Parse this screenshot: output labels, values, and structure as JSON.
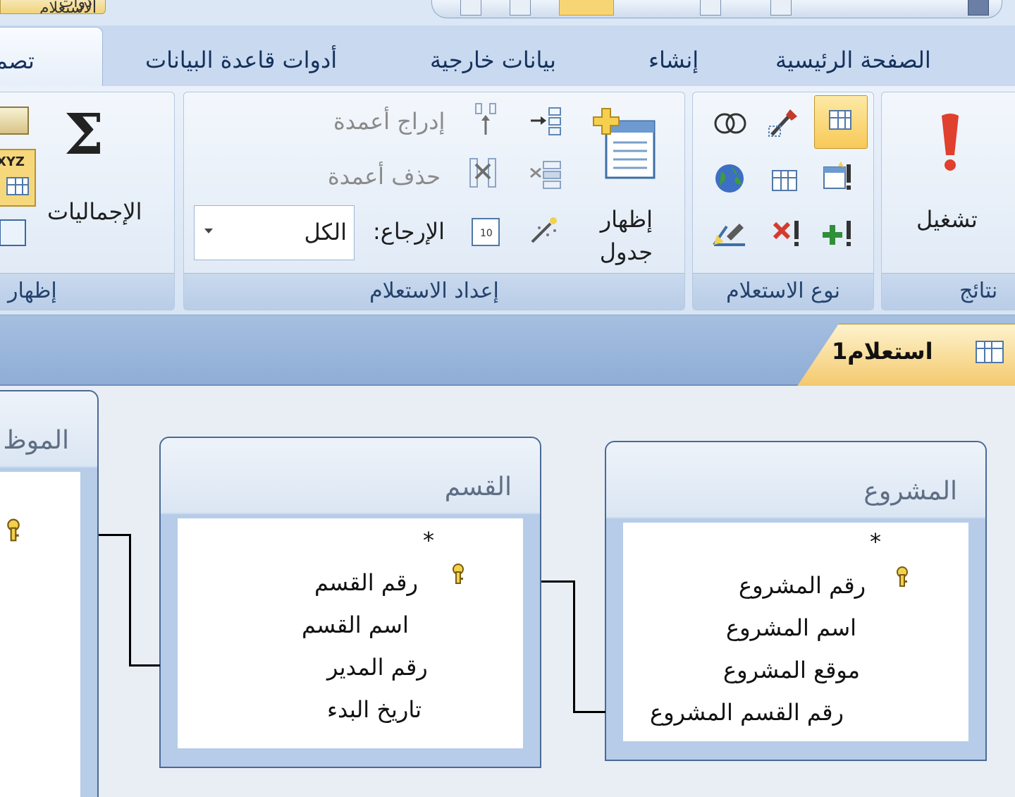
{
  "quick_access": {
    "context_tab_label": "أدوات الاستعلام"
  },
  "tabs": {
    "home": "الصفحة الرئيسية",
    "create": "إنشاء",
    "external_data": "بيانات خارجية",
    "database_tools": "أدوات قاعدة البيانات",
    "design_partial": "تصم"
  },
  "ribbon": {
    "results": {
      "label_partial": "نتائج",
      "run": "تشغيل"
    },
    "query_type": {
      "label": "نوع الاستعلام"
    },
    "query_setup": {
      "label": "إعداد الاستعلام",
      "show_table_line1": "إظهار",
      "show_table_line2": "جدول",
      "insert_columns": "إدراج أعمدة",
      "delete_columns": "حذف أعمدة",
      "return_label": "الإرجاع:",
      "return_value": "الكل"
    },
    "show_hide": {
      "label_partial": "إظهار",
      "totals": "الإجماليات",
      "xyz": "XYZ"
    }
  },
  "document": {
    "tab_title": "استعلام1"
  },
  "tables": {
    "project": {
      "title": "المشروع",
      "fields": [
        "*",
        "رقم المشروع",
        "اسم المشروع",
        "موقع المشروع",
        "رقم القسم المشروع"
      ]
    },
    "department": {
      "title": "القسم",
      "fields": [
        "*",
        "رقم القسم",
        "اسم القسم",
        "رقم المدير",
        "تاريخ البدء"
      ]
    },
    "employee": {
      "title_partial": "الموظ"
    }
  },
  "colors": {
    "ribbon_bg": "#d7e4f4",
    "tab_text": "#15315d",
    "highlight": "#f8c957",
    "doc_tab": "#f4c86b",
    "table_border": "#4a6a95"
  }
}
